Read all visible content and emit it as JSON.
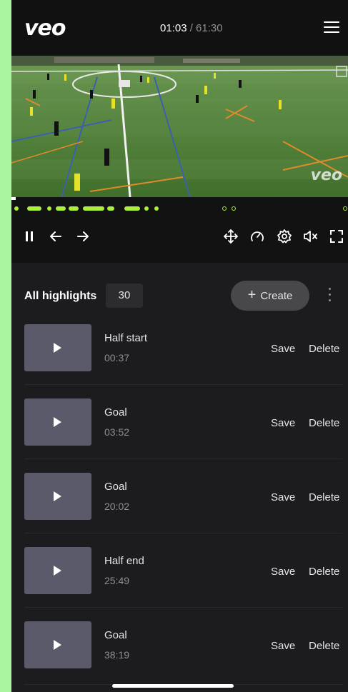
{
  "header": {
    "logo": "veo",
    "time_current": "01:03",
    "time_total": " / 61:30",
    "menu_icon": "hamburger-menu-icon"
  },
  "video": {
    "watermark": "veo"
  },
  "controls": {
    "icons": [
      "pause-icon",
      "back-arrow-icon",
      "forward-arrow-icon",
      "move-icon",
      "speed-icon",
      "settings-icon",
      "mute-icon",
      "fullscreen-icon"
    ]
  },
  "highlights": {
    "title": "All highlights",
    "count": "30",
    "create_label": "Create",
    "items": [
      {
        "name": "Half start",
        "time": "00:37",
        "save": "Save",
        "delete": "Delete"
      },
      {
        "name": "Goal",
        "time": "03:52",
        "save": "Save",
        "delete": "Delete"
      },
      {
        "name": "Goal",
        "time": "20:02",
        "save": "Save",
        "delete": "Delete"
      },
      {
        "name": "Half end",
        "time": "25:49",
        "save": "Save",
        "delete": "Delete"
      },
      {
        "name": "Goal",
        "time": "38:19",
        "save": "Save",
        "delete": "Delete"
      }
    ]
  },
  "colors": {
    "accent": "#a9f03a",
    "background": "#1c1c1e",
    "frame": "#a9f5a0"
  }
}
